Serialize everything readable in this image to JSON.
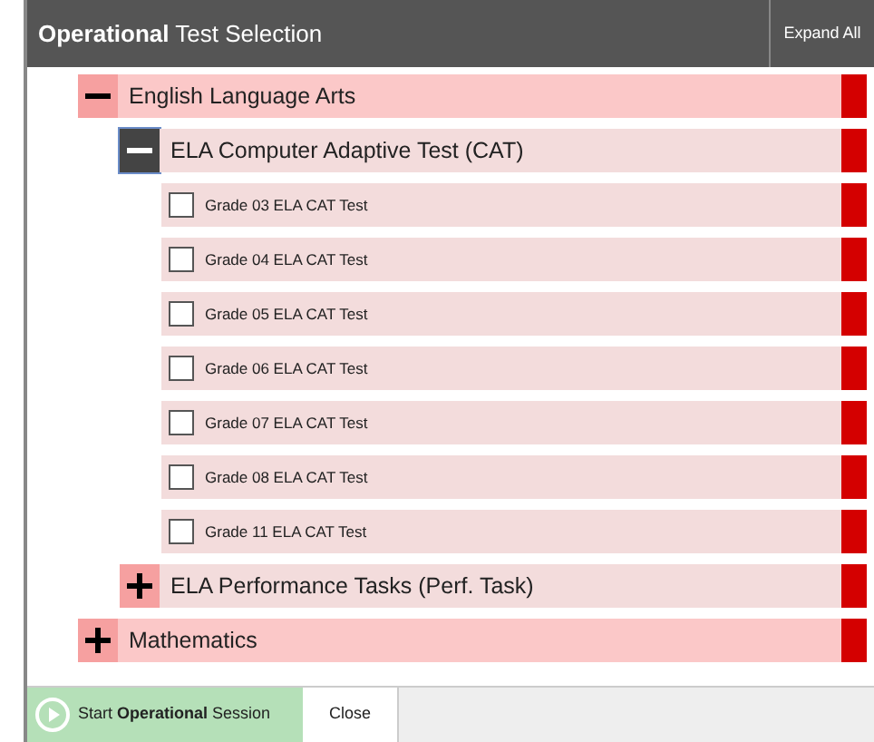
{
  "header": {
    "title": "**Operational** Test Selection",
    "expand_all": "Expand All"
  },
  "tree": [
    {
      "kind": "group",
      "label": "English Language Arts",
      "expanded": true,
      "focused": false,
      "children": [
        {
          "kind": "group",
          "label": "ELA Computer Adaptive Test (CAT)",
          "expanded": true,
          "focused": true,
          "children": [
            {
              "kind": "test",
              "label": "Grade 03 ELA CAT Test",
              "checked": false
            },
            {
              "kind": "test",
              "label": "Grade 04 ELA CAT Test",
              "checked": false
            },
            {
              "kind": "test",
              "label": "Grade 05 ELA CAT Test",
              "checked": false
            },
            {
              "kind": "test",
              "label": "Grade 06 ELA CAT Test",
              "checked": false
            },
            {
              "kind": "test",
              "label": "Grade 07 ELA CAT Test",
              "checked": false
            },
            {
              "kind": "test",
              "label": "Grade 08 ELA CAT Test",
              "checked": false
            },
            {
              "kind": "test",
              "label": "Grade 11 ELA CAT Test",
              "checked": false
            }
          ]
        },
        {
          "kind": "group",
          "label": "ELA Performance Tasks (Perf. Task)",
          "expanded": false,
          "focused": false
        }
      ]
    },
    {
      "kind": "group",
      "label": "Mathematics",
      "expanded": false,
      "focused": false
    }
  ],
  "footer": {
    "start_button": "Start **Operational** Session",
    "close_button": "Close"
  }
}
